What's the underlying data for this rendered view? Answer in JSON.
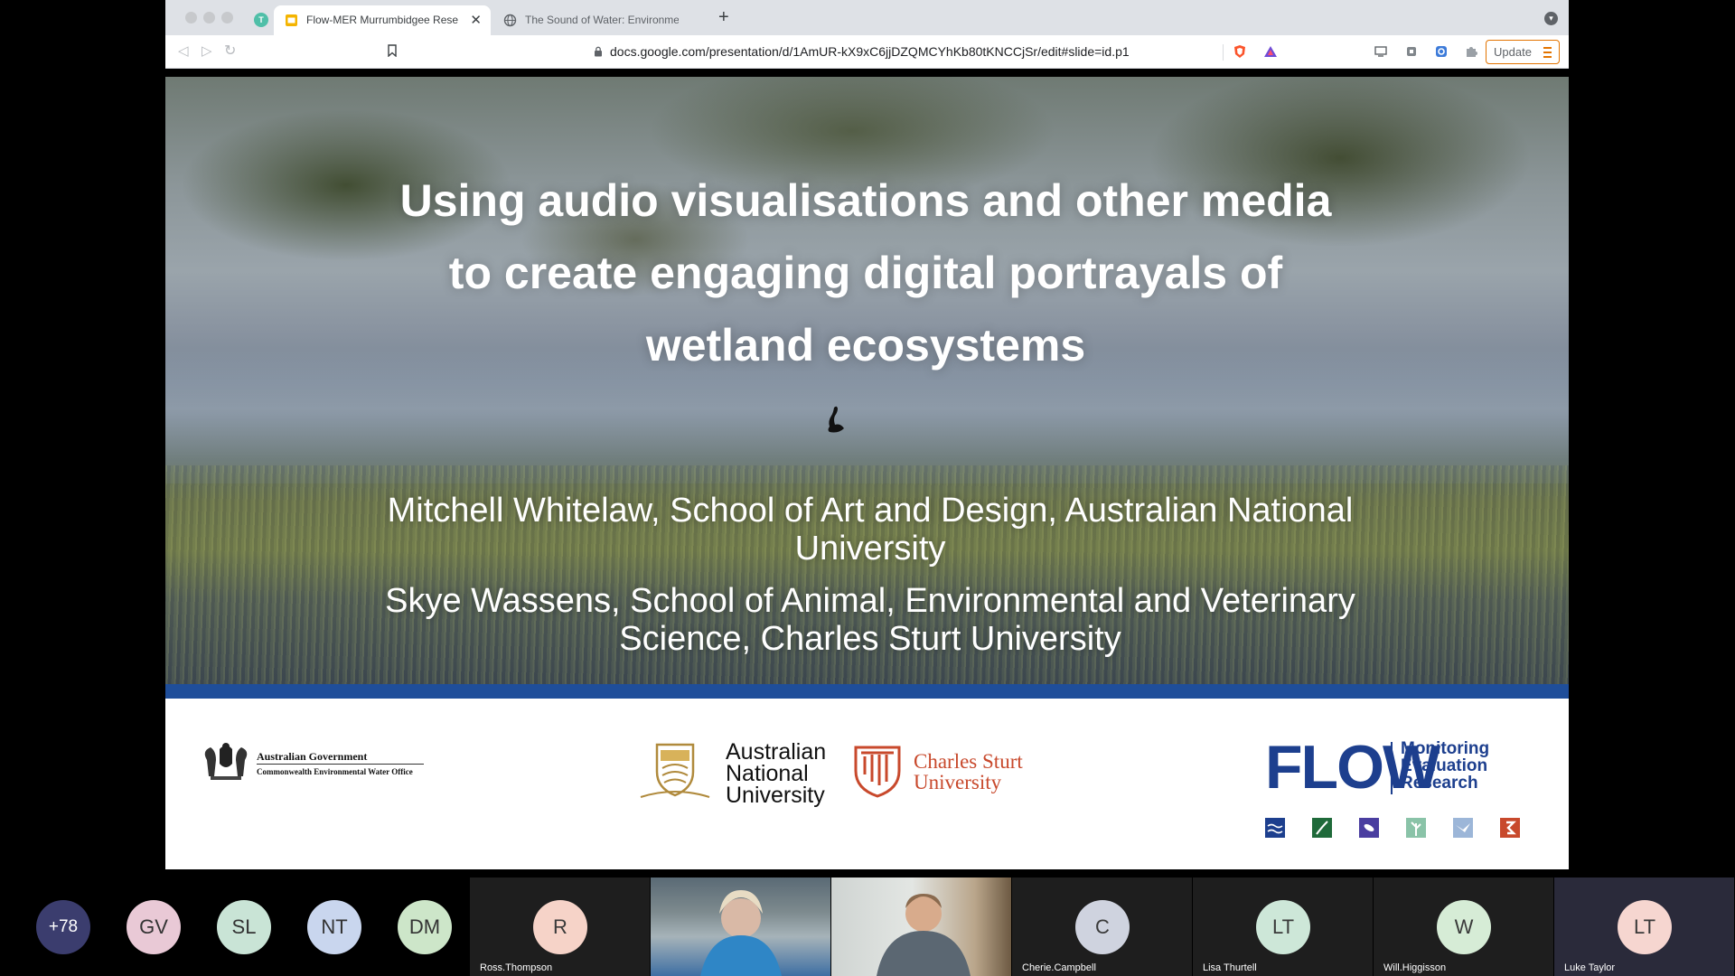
{
  "browser": {
    "profile_initial": "T",
    "tabs": [
      {
        "title": "Flow-MER Murrumbidgee Rese",
        "active": true
      },
      {
        "title": "The Sound of Water: Environmental",
        "active": false
      }
    ],
    "new_tab_symbol": "+",
    "close_symbol": "✕",
    "url": "docs.google.com/presentation/d/1AmUR-kX9xC6jjDZQMCYhKb80tKNCCjSr/edit#slide=id.p1",
    "update_label": "Update",
    "accent_color": "#e37400"
  },
  "slide": {
    "title": "Using audio visualisations and other media to create engaging digital portrayals of wetland ecosystems",
    "authors": [
      "Mitchell Whitelaw, School of Art and Design, Australian National University",
      "Skye Wassens,  School of Animal, Environmental and Veterinary Science, Charles Sturt University"
    ],
    "band_color": "#1f4e9a",
    "logos": {
      "gov_line1": "Australian Government",
      "gov_line2": "Commonwealth Environmental Water Office",
      "anu": "Australian National University",
      "csu": "Charles Sturt University",
      "flow_word": "FLOW",
      "flow_right": [
        "Monitoring",
        "Evaluation",
        "Research"
      ]
    }
  },
  "participants": {
    "more_count": "+78",
    "bubbles": [
      {
        "initials": "GV",
        "color": "#e9c9d6"
      },
      {
        "initials": "SL",
        "color": "#c9e4d6"
      },
      {
        "initials": "NT",
        "color": "#c9d6ee"
      },
      {
        "initials": "DM",
        "color": "#cde6c9"
      }
    ],
    "tiles": [
      {
        "initials": "R",
        "name": "Ross.Thompson",
        "color": "#f6d3c8",
        "video": false
      },
      {
        "initials": "",
        "name": "",
        "color": "",
        "video": true
      },
      {
        "initials": "",
        "name": "",
        "color": "",
        "video": true
      },
      {
        "initials": "C",
        "name": "Cherie.Campbell",
        "color": "#cfd3df",
        "video": false
      },
      {
        "initials": "LT",
        "name": "Lisa Thurtell",
        "color": "#cde7d8",
        "video": false
      },
      {
        "initials": "W",
        "name": "Will.Higgisson",
        "color": "#d6ecd6",
        "video": false
      },
      {
        "initials": "LT",
        "name": "Luke Taylor",
        "color": "#f6d6d0",
        "video": false
      }
    ]
  }
}
